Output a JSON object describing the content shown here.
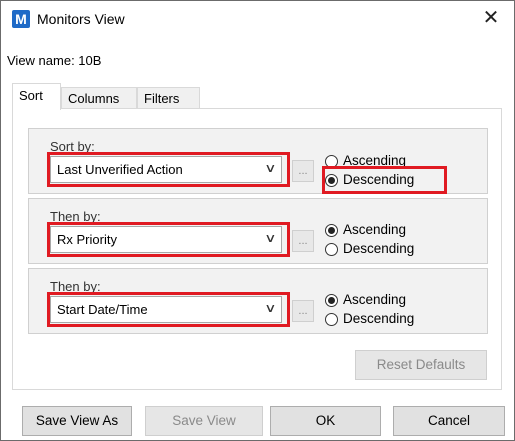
{
  "window": {
    "app_icon": "M",
    "title": "Monitors View",
    "close_glyph": "✕"
  },
  "view_name": "View name: 10B",
  "tabs": [
    {
      "label": "Sort"
    },
    {
      "label": "Columns"
    },
    {
      "label": "Filters"
    }
  ],
  "sort_rows": [
    {
      "label": "Sort by:",
      "value": "Last Unverified Action",
      "ascending_label": "Ascending",
      "descending_label": "Descending",
      "selected": "Descending"
    },
    {
      "label": "Then by:",
      "value": "Rx Priority",
      "ascending_label": "Ascending",
      "descending_label": "Descending",
      "selected": "Ascending"
    },
    {
      "label": "Then by:",
      "value": "Start Date/Time",
      "ascending_label": "Ascending",
      "descending_label": "Descending",
      "selected": "Ascending"
    }
  ],
  "ellipsis_label": "...",
  "reset_defaults": "Reset Defaults",
  "footer": {
    "save_view_as": "Save View As",
    "save_view": "Save View",
    "ok": "OK",
    "cancel": "Cancel"
  },
  "colors": {
    "highlight": "#e01a22",
    "app_icon_bg": "#1e6ac7"
  }
}
